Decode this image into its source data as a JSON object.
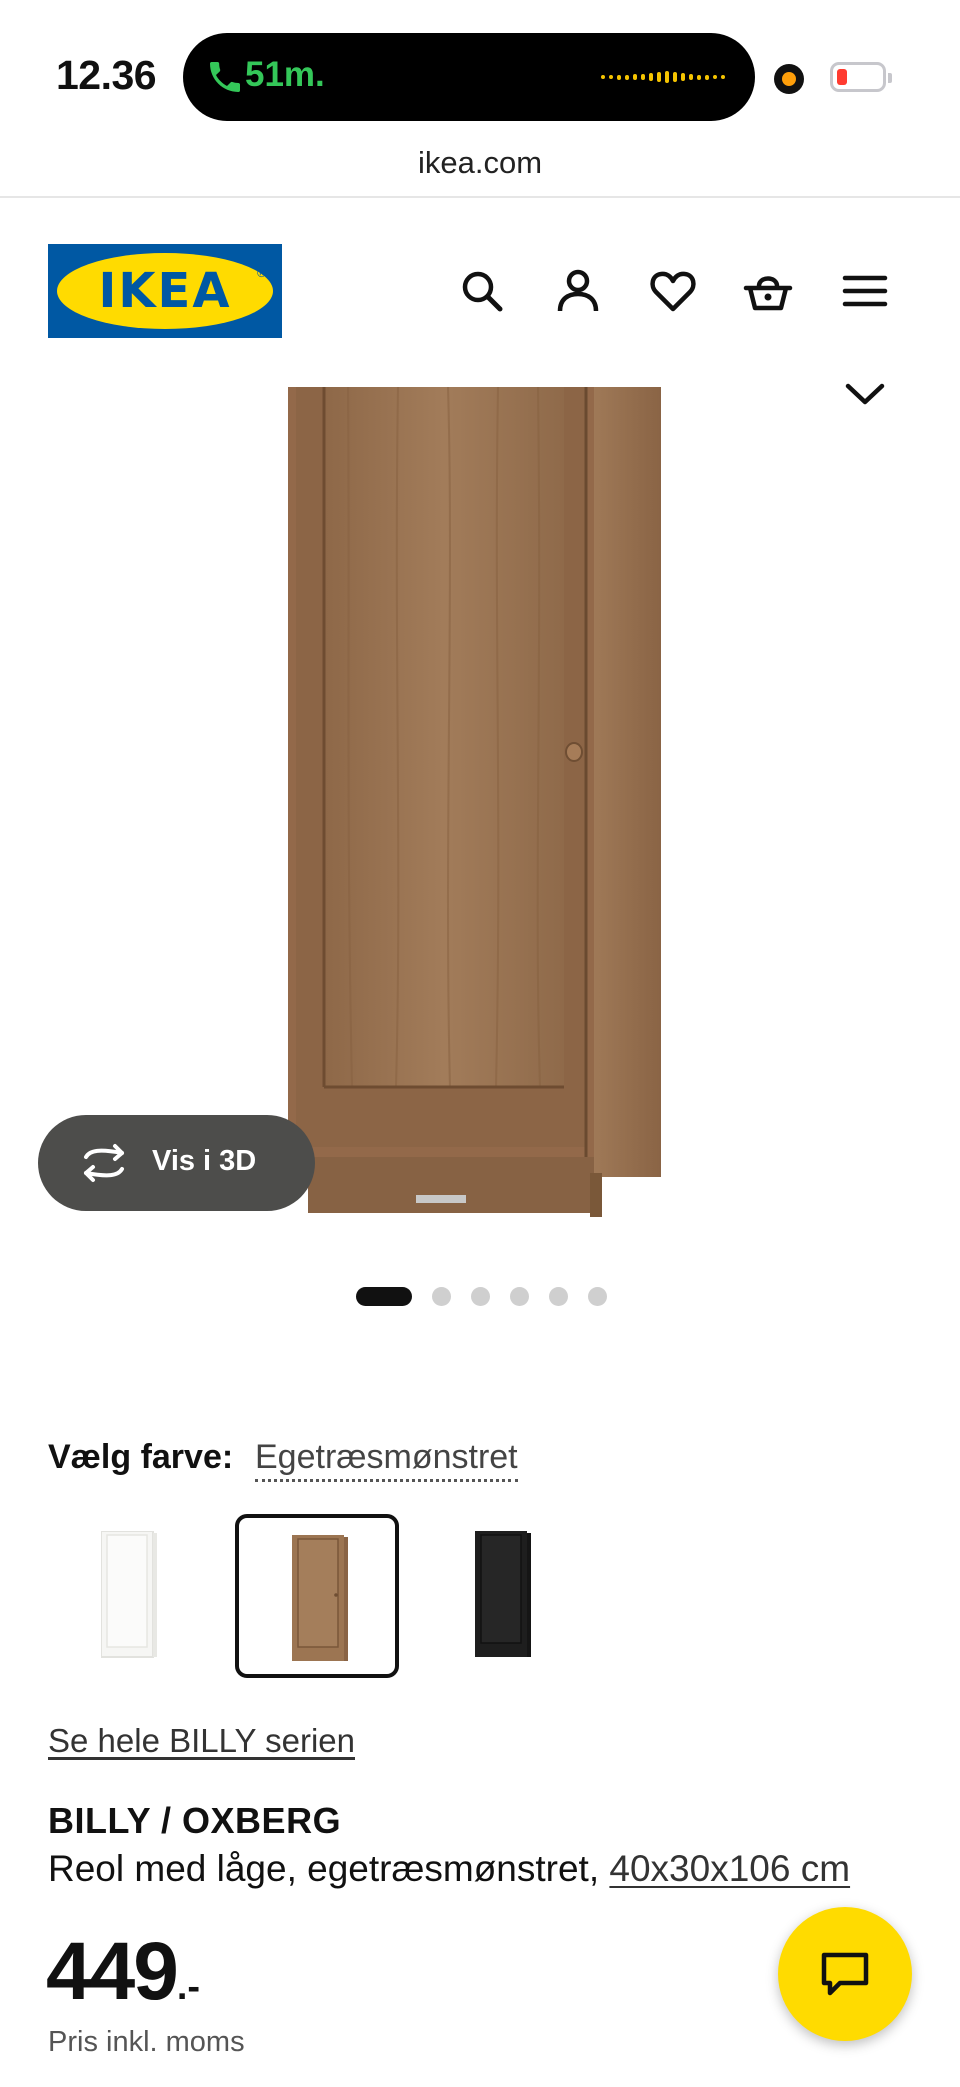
{
  "status_bar": {
    "time": "12.36",
    "call_duration": "51m."
  },
  "browser": {
    "url": "ikea.com"
  },
  "header": {
    "logo_text": "IKEA",
    "icons": [
      "search-icon",
      "account-icon",
      "heart-icon",
      "basket-icon",
      "menu-icon"
    ]
  },
  "gallery": {
    "view_3d_label": "Vis i 3D",
    "total_images": 6,
    "active_image": 1
  },
  "color_picker": {
    "label": "Vælg farve:",
    "selected_value": "Egetræsmønstret",
    "options": [
      {
        "name": "white",
        "color": "#f4f4f2",
        "selected": false
      },
      {
        "name": "oak",
        "color": "#9c7552",
        "selected": true
      },
      {
        "name": "black",
        "color": "#1e1e1e",
        "selected": false
      }
    ]
  },
  "product": {
    "series_link": "Se hele BILLY serien",
    "name": "BILLY / OXBERG",
    "description": "Reol med låge, egetræsmønstret, ",
    "measurements": "40x30x106 cm",
    "price_integer": "449",
    "price_suffix": ".-",
    "price_note": "Pris inkl. moms"
  },
  "colors": {
    "brand_blue": "#0058a3",
    "brand_yellow": "#ffdb00",
    "wood": "#9c7552"
  }
}
